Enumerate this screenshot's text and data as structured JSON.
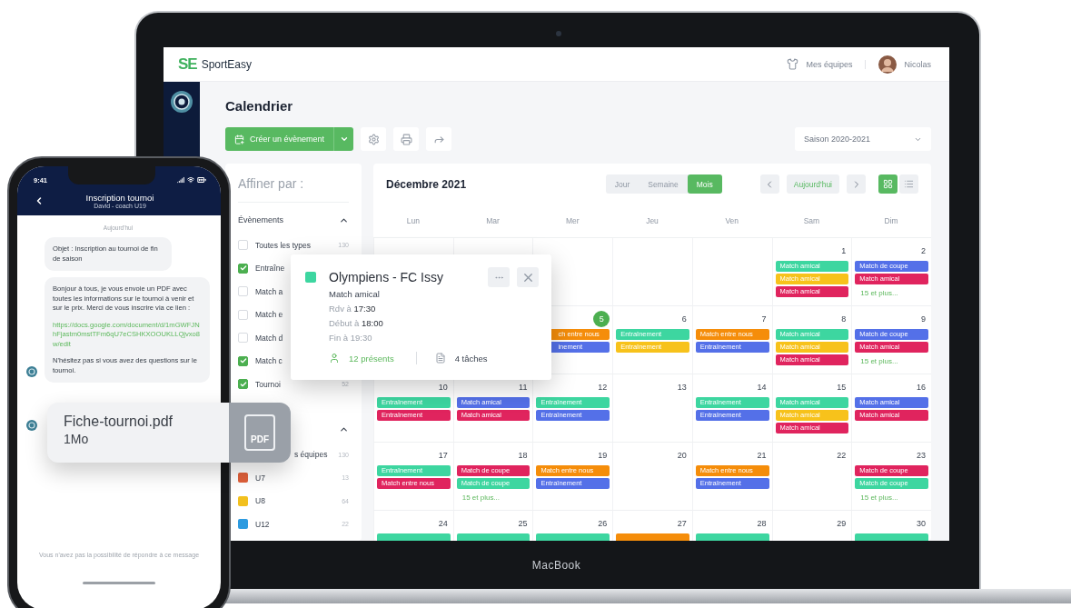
{
  "header": {
    "logo_mark": "SE",
    "brand": "SportEasy",
    "teams_link": "Mes équipes",
    "user": "Nicolas"
  },
  "page": {
    "title": "Calendrier",
    "create_button": "Créer un évènement",
    "season_select": "Saison 2020-2021"
  },
  "filters": {
    "title": "Affiner par :",
    "events_section": {
      "title": "Évènements",
      "expanded": true,
      "items": [
        {
          "label": "Toutes les types",
          "count": "130",
          "checked": false
        },
        {
          "label": "Entraîne",
          "checked": true
        },
        {
          "label": "Match a",
          "checked": false
        },
        {
          "label": "Match e",
          "checked": false
        },
        {
          "label": "Match d",
          "checked": false
        },
        {
          "label": "Match c",
          "checked": true
        },
        {
          "label": "Tournoi",
          "count": "52",
          "checked": true
        }
      ]
    },
    "teams_section": {
      "expanded": true,
      "items": [
        {
          "label": "s équipes",
          "count": "130",
          "covered": true
        },
        {
          "label": "U7",
          "count": "13",
          "color": "#e0603a",
          "covered": false
        },
        {
          "label": "U8",
          "count": "64",
          "color": "#f2c01e",
          "covered": false
        },
        {
          "label": "U12",
          "count": "22",
          "color": "#2d9be0",
          "covered": false
        }
      ]
    }
  },
  "calendar": {
    "month": "Décembre 2021",
    "views": [
      {
        "label": "Jour",
        "selected": false
      },
      {
        "label": "Semaine",
        "selected": false
      },
      {
        "label": "Mois",
        "selected": true
      }
    ],
    "today_button": "Aujourd'hui",
    "layouts": [
      {
        "kind": "grid",
        "selected": true
      },
      {
        "kind": "list",
        "selected": false
      }
    ],
    "weekdays": [
      "Lun",
      "Mar",
      "Mer",
      "Jeu",
      "Ven",
      "Sam",
      "Dim"
    ],
    "weeks": [
      {
        "days": [
          {
            "kind": "blank"
          },
          {
            "kind": "blank"
          },
          {
            "kind": "blank"
          },
          {
            "kind": "blank"
          },
          {
            "kind": "blank"
          },
          {
            "kind": "day",
            "date": "1",
            "today": false,
            "events": [
              {
                "label": "Match amical",
                "color": "#3dd6a0"
              },
              {
                "label": "Match amical",
                "color": "#f7c21b"
              },
              {
                "label": "Match amical",
                "color": "#e0245e"
              }
            ]
          },
          {
            "kind": "day",
            "date": "2",
            "today": false,
            "events": [
              {
                "label": "Match de coupe",
                "color": "#5470e8"
              },
              {
                "label": "Match amical",
                "color": "#e0245e"
              }
            ],
            "more": "15 et plus..."
          }
        ]
      },
      {
        "days": [
          {
            "kind": "blank"
          },
          {
            "kind": "blank"
          },
          {
            "kind": "day",
            "date": "5",
            "today": true,
            "covered": true,
            "events": [
              {
                "label": "ch entre nous",
                "color": "#f58d0a"
              },
              {
                "label": "inement",
                "color": "#5470e8"
              }
            ]
          },
          {
            "kind": "day",
            "date": "6",
            "today": false,
            "events": [
              {
                "label": "Entraînement",
                "color": "#3dd6a0"
              },
              {
                "label": "Entraînement",
                "color": "#f7c21b"
              }
            ]
          },
          {
            "kind": "day",
            "date": "7",
            "today": false,
            "events": [
              {
                "label": "Match entre nous",
                "color": "#f58d0a"
              },
              {
                "label": "Entraînement",
                "color": "#5470e8"
              }
            ]
          },
          {
            "kind": "day",
            "date": "8",
            "today": false,
            "events": [
              {
                "label": "Match amical",
                "color": "#3dd6a0"
              },
              {
                "label": "Match amical",
                "color": "#f7c21b"
              },
              {
                "label": "Match amical",
                "color": "#e0245e"
              }
            ]
          },
          {
            "kind": "day",
            "date": "9",
            "today": false,
            "events": [
              {
                "label": "Match de coupe",
                "color": "#5470e8"
              },
              {
                "label": "Match amical",
                "color": "#e0245e"
              }
            ],
            "more": "15 et plus..."
          }
        ]
      },
      {
        "days": [
          {
            "kind": "day",
            "date": "10",
            "today": false,
            "events": [
              {
                "label": "Entraînement",
                "color": "#3dd6a0"
              },
              {
                "label": "Entraînement",
                "color": "#e0245e"
              }
            ]
          },
          {
            "kind": "day",
            "date": "11",
            "today": false,
            "events": [
              {
                "label": "Match amical",
                "color": "#5470e8"
              },
              {
                "label": "Match amical",
                "color": "#e0245e"
              }
            ]
          },
          {
            "kind": "day",
            "date": "12",
            "today": false,
            "events": [
              {
                "label": "Entraînement",
                "color": "#3dd6a0"
              },
              {
                "label": "Entraînement",
                "color": "#5470e8"
              }
            ]
          },
          {
            "kind": "day",
            "date": "13",
            "today": false
          },
          {
            "kind": "day",
            "date": "14",
            "today": false,
            "events": [
              {
                "label": "Entraînement",
                "color": "#3dd6a0"
              },
              {
                "label": "Entraînement",
                "color": "#5470e8"
              }
            ]
          },
          {
            "kind": "day",
            "date": "15",
            "today": false,
            "events": [
              {
                "label": "Match amical",
                "color": "#3dd6a0"
              },
              {
                "label": "Match amical",
                "color": "#f7c21b"
              },
              {
                "label": "Match amical",
                "color": "#e0245e"
              }
            ]
          },
          {
            "kind": "day",
            "date": "16",
            "today": false,
            "events": [
              {
                "label": "Match amical",
                "color": "#5470e8"
              },
              {
                "label": "Match amical",
                "color": "#e0245e"
              }
            ]
          }
        ]
      },
      {
        "days": [
          {
            "kind": "day",
            "date": "17",
            "today": false,
            "events": [
              {
                "label": "Entraînement",
                "color": "#3dd6a0"
              },
              {
                "label": "Match entre nous",
                "color": "#e0245e"
              }
            ]
          },
          {
            "kind": "day",
            "date": "18",
            "today": false,
            "events": [
              {
                "label": "Match de coupe",
                "color": "#e0245e"
              },
              {
                "label": "Match de coupe",
                "color": "#3dd6a0"
              }
            ],
            "more": "15 et plus..."
          },
          {
            "kind": "day",
            "date": "19",
            "today": false,
            "events": [
              {
                "label": "Match entre nous",
                "color": "#f58d0a"
              },
              {
                "label": "Entraînement",
                "color": "#5470e8"
              }
            ]
          },
          {
            "kind": "day",
            "date": "20",
            "today": false
          },
          {
            "kind": "day",
            "date": "21",
            "today": false,
            "events": [
              {
                "label": "Match entre nous",
                "color": "#f58d0a"
              },
              {
                "label": "Entraînement",
                "color": "#5470e8"
              }
            ]
          },
          {
            "kind": "day",
            "date": "22",
            "today": false
          },
          {
            "kind": "day",
            "date": "23",
            "today": false,
            "events": [
              {
                "label": "Match de coupe",
                "color": "#e0245e"
              },
              {
                "label": "Match de coupe",
                "color": "#3dd6a0"
              }
            ],
            "more": "15 et plus..."
          }
        ]
      },
      {
        "days": [
          {
            "kind": "day",
            "date": "24",
            "today": false,
            "events": [
              {
                "color": "#3dd6a0"
              }
            ]
          },
          {
            "kind": "day",
            "date": "25",
            "today": false,
            "events": [
              {
                "color": "#3dd6a0"
              }
            ]
          },
          {
            "kind": "day",
            "date": "26",
            "today": false,
            "events": [
              {
                "color": "#3dd6a0"
              }
            ]
          },
          {
            "kind": "day",
            "date": "27",
            "today": false,
            "events": [
              {
                "color": "#f58d0a"
              }
            ]
          },
          {
            "kind": "day",
            "date": "28",
            "today": false,
            "events": [
              {
                "color": "#3dd6a0"
              }
            ]
          },
          {
            "kind": "day",
            "date": "29",
            "today": false
          },
          {
            "kind": "day",
            "date": "30",
            "today": false,
            "events": [
              {
                "color": "#3dd6a0"
              }
            ]
          }
        ]
      }
    ]
  },
  "popup": {
    "color": "#3dd6a0",
    "title": "Olympiens - FC Issy",
    "type": "Match amical",
    "lines": [
      "Rdv à **17:30**",
      "Début à **18:00**",
      "Fin à 19:30"
    ],
    "attendance": "12 présents",
    "tasks": "4 tâches"
  },
  "phone": {
    "time": "9:41",
    "title": "Inscription tournoi",
    "subtitle": "David - coach U19",
    "day": "Aujourd'hui",
    "messages": [
      {
        "avatar": false,
        "paragraphs": [
          {
            "kind": "text",
            "text": "Objet : Inscription au tournoi de fin de saison"
          }
        ]
      },
      {
        "avatar": true,
        "paragraphs": [
          {
            "kind": "text",
            "text": "Bonjour à tous, je vous envoie un PDF avec toutes les informations sur le tournoi à venir et sur le prix. Merci de vous inscrire via ce lien :"
          },
          {
            "kind": "link",
            "text": "https://docs.google.com/document/d/1mGWFJNhFjastm0mstTFm6qU7eCSHKXOOUKLLQjvxo8w/edit"
          },
          {
            "kind": "text",
            "text": "N'hésitez pas si vous avez des questions sur le tournoi."
          }
        ]
      }
    ],
    "attachment": {
      "name": "Fiche-tournoi.pdf",
      "size": "1Mo",
      "icon_label": "PDF"
    },
    "footer": "Vous n'avez pas la possibilité de répondre à ce message"
  },
  "device": {
    "label": "MacBook"
  }
}
